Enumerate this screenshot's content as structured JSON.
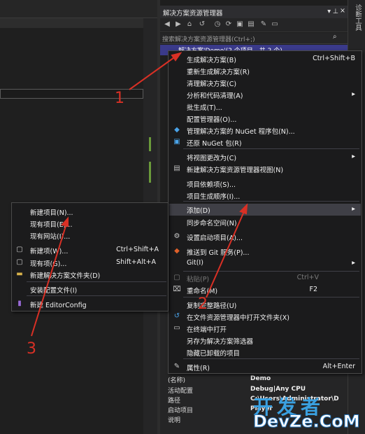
{
  "solution_explorer": {
    "title": "解决方案资源管理器",
    "search_placeholder": "搜索解决方案资源管理器(Ctrl+;)",
    "selected_node": "解决方案'Demo'(2 个项目，共 2 个)"
  },
  "right_strip": {
    "label": "诊断工具"
  },
  "main_menu": {
    "items": [
      {
        "label": "生成解决方案(B)",
        "shortcut": "Ctrl+Shift+B"
      },
      {
        "label": "重新生成解决方案(R)",
        "shortcut": ""
      },
      {
        "label": "清理解决方案(C)",
        "shortcut": ""
      },
      {
        "label": "分析和代码清理(A)",
        "shortcut": ""
      },
      {
        "label": "批生成(T)...",
        "shortcut": ""
      },
      {
        "label": "配置管理器(O)...",
        "shortcut": ""
      },
      {
        "label": "管理解决方案的 NuGet 程序包(N)...",
        "shortcut": ""
      },
      {
        "label": "还原 NuGet 包(R)",
        "shortcut": ""
      },
      {
        "label": "将视图更改为(C)",
        "shortcut": ""
      },
      {
        "label": "新建解决方案资源管理器视图(N)",
        "shortcut": ""
      },
      {
        "label": "项目依赖项(S)...",
        "shortcut": ""
      },
      {
        "label": "项目生成顺序(I)...",
        "shortcut": ""
      },
      {
        "label": "添加(D)",
        "shortcut": ""
      },
      {
        "label": "同步命名空间(N)",
        "shortcut": ""
      },
      {
        "label": "设置启动项目(A)...",
        "shortcut": ""
      },
      {
        "label": "推送到 Git 服务(P)...",
        "shortcut": ""
      },
      {
        "label": "Git(I)",
        "shortcut": ""
      },
      {
        "label": "粘贴(P)",
        "shortcut": "Ctrl+V"
      },
      {
        "label": "重命名(M)",
        "shortcut": "F2"
      },
      {
        "label": "复制完整路径(U)",
        "shortcut": ""
      },
      {
        "label": "在文件资源管理器中打开文件夹(X)",
        "shortcut": ""
      },
      {
        "label": "在终端中打开",
        "shortcut": ""
      },
      {
        "label": "另存为解决方案筛选器",
        "shortcut": ""
      },
      {
        "label": "隐藏已卸载的项目",
        "shortcut": ""
      },
      {
        "label": "属性(R)",
        "shortcut": "Alt+Enter"
      }
    ]
  },
  "sub_menu": {
    "items": [
      {
        "label": "新建项目(N)...",
        "shortcut": ""
      },
      {
        "label": "现有项目(E)...",
        "shortcut": ""
      },
      {
        "label": "现有网站(I)...",
        "shortcut": ""
      },
      {
        "label": "新建项(W)...",
        "shortcut": "Ctrl+Shift+A"
      },
      {
        "label": "现有项(G)...",
        "shortcut": "Shift+Alt+A"
      },
      {
        "label": "新建解决方案文件夹(D)",
        "shortcut": ""
      },
      {
        "label": "安装配置文件(I)",
        "shortcut": ""
      },
      {
        "label": "新建 EditorConfig",
        "shortcut": ""
      }
    ]
  },
  "properties": {
    "rows": [
      {
        "key": "(名称)",
        "value": "Demo"
      },
      {
        "key": "活动配置",
        "value": "Debug|Any CPU"
      },
      {
        "key": "路径",
        "value": "C:\\Users\\Administrator\\D"
      },
      {
        "key": "启动项目",
        "value": "Player"
      },
      {
        "key": "说明",
        "value": ""
      }
    ]
  },
  "annotations": {
    "a1": "1",
    "a2": "2",
    "a3": "3",
    "color": "#d93025"
  },
  "watermark": {
    "line1": "开发者",
    "line2": "DevZe.CoM"
  }
}
